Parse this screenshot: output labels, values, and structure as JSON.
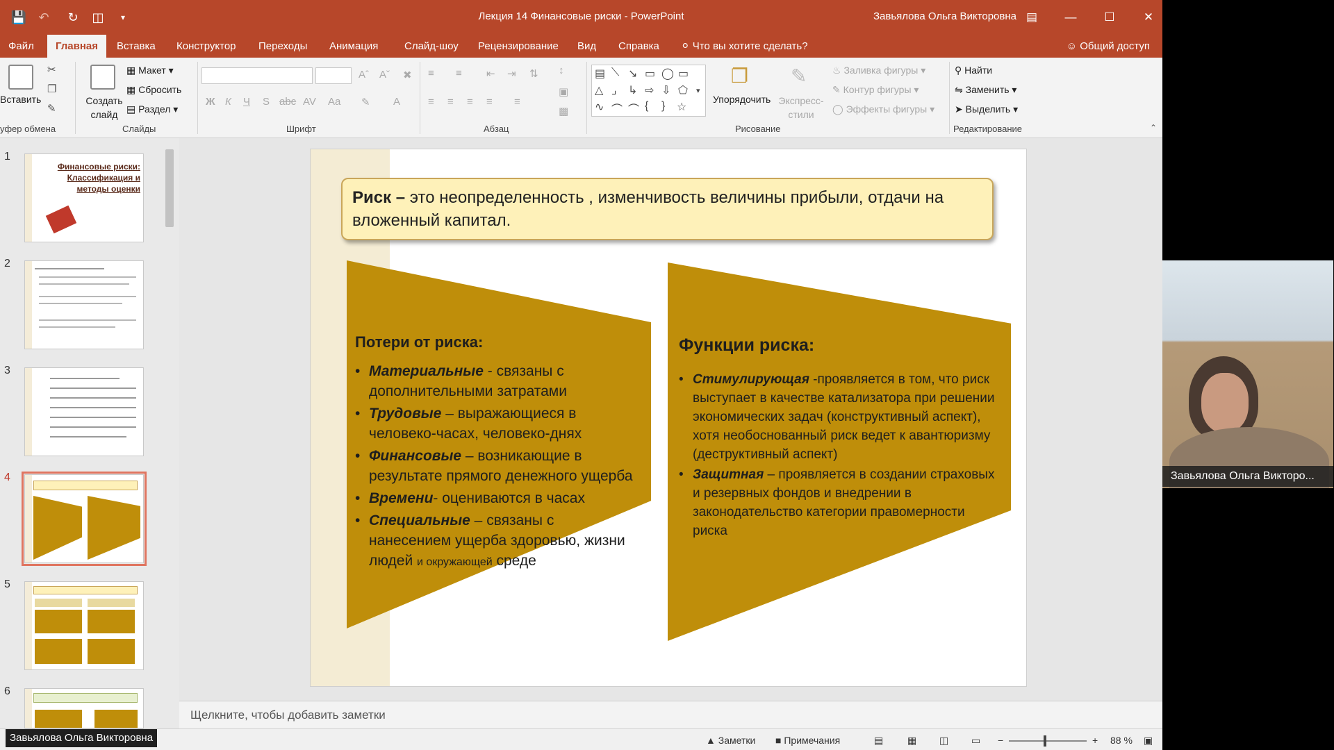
{
  "titlebar": {
    "doc_title": "Лекция 14 Финансовые риски  -  PowerPoint",
    "user": "Завьялова Ольга Викторовна"
  },
  "colors": {
    "accent": "#b7472a",
    "gold": "#bf8e0a",
    "callout_bg": "#fef1b9",
    "selected_outline": "#e07560"
  },
  "tabs": [
    "Файл",
    "Главная",
    "Вставка",
    "Конструктор",
    "Переходы",
    "Анимация",
    "Слайд-шоу",
    "Рецензирование",
    "Вид",
    "Справка"
  ],
  "tell_me": "Что вы хотите сделать?",
  "share": "Общий доступ",
  "ribbon": {
    "clipboard": {
      "paste": "Вставить",
      "label": "уфер обмена"
    },
    "slides": {
      "new_slide": "Создать слайд",
      "layout": "Макет",
      "reset": "Сбросить",
      "section": "Раздел",
      "label": "Слайды"
    },
    "font": {
      "label": "Шрифт"
    },
    "paragraph": {
      "label": "Абзац"
    },
    "drawing": {
      "arrange": "Упорядочить",
      "quick_styles": "Экспресс-стили",
      "fill": "Заливка фигуры",
      "outline": "Контур фигуры",
      "effects": "Эффекты фигуры",
      "label": "Рисование"
    },
    "editing": {
      "find": "Найти",
      "replace": "Заменить",
      "select": "Выделить",
      "label": "Редактирование"
    }
  },
  "slides_panel": {
    "numbers": [
      "1",
      "2",
      "3",
      "4",
      "5",
      "6"
    ],
    "thumb1_title": "Финансовые риски: Классификация и методы оценки",
    "selected": 4
  },
  "slide": {
    "definition_term": "Риск –",
    "definition_text": " это неопределенность , изменчивость величины прибыли, отдачи на вложенный капитал.",
    "left": {
      "title": "Потери от риска:",
      "items": [
        {
          "term": "Материальные",
          "text": " - связаны с дополнительными затратами"
        },
        {
          "term": "Трудовые",
          "text": " – выражающиеся в человеко-часах, человеко-днях"
        },
        {
          "term": "Финансовые",
          "text": " – возникающие в результате прямого денежного ущерба"
        },
        {
          "term": "Времени",
          "text": "- оцениваются в часах"
        },
        {
          "term": "Специальные",
          "text": " – связаны с нанесением ущерба здоровью, жизни людей ",
          "small": "и окружающей",
          "tail": " среде"
        }
      ]
    },
    "right": {
      "title": "Функции риска:",
      "items": [
        {
          "term": "Стимулирующая",
          "text": " -проявляется в том, что риск выступает в качестве катализатора при решении экономических задач (конструктивный аспект), хотя необоснованный риск ведет к авантюризму (деструктивный аспект)"
        },
        {
          "term": "Защитная",
          "text": " – проявляется в создании страховых и резервных фондов и внедрении в законодательство категории правомерности риска"
        }
      ]
    }
  },
  "notes_placeholder": "Щелкните, чтобы добавить заметки",
  "statusbar": {
    "notes": "Заметки",
    "comments": "Примечания",
    "zoom": "88 %"
  },
  "presenter_label": "Завьялова Ольга Викторовна",
  "webcam_label": "Завьялова Ольга Викторо..."
}
